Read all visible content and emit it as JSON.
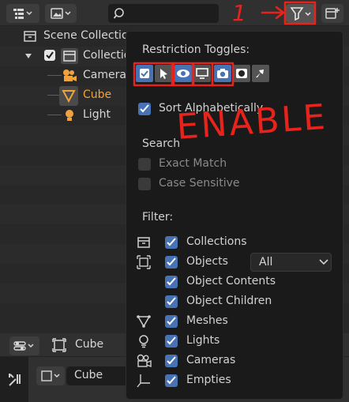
{
  "outliner": {
    "scene_collection": "Scene Collection",
    "collection": "Collection",
    "camera": "Camera",
    "cube": "Cube",
    "light": "Light"
  },
  "popover": {
    "restriction_toggles": "Restriction Toggles:",
    "sort_alphabetically": "Sort Alphabetically",
    "search_heading": "Search",
    "exact_match": "Exact Match",
    "case_sensitive": "Case Sensitive",
    "filter_heading": "Filter:",
    "collections": "Collections",
    "objects": "Objects",
    "objects_dropdown": "All",
    "object_contents": "Object Contents",
    "object_children": "Object Children",
    "meshes": "Meshes",
    "lights": "Lights",
    "cameras": "Cameras",
    "empties": "Empties"
  },
  "properties": {
    "object_name": "Cube",
    "object_field": "Cube"
  },
  "annotations": {
    "step": "1",
    "note": "ENABLE"
  },
  "colors": {
    "accent": "#4772b3",
    "annotation_red": "#e8231b",
    "active_object": "#f0a23c"
  }
}
